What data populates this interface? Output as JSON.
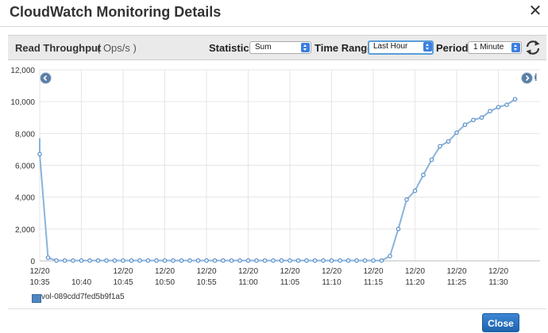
{
  "modal": {
    "title": "CloudWatch Monitoring Details"
  },
  "toolbar": {
    "metric_title": "Read Throughput",
    "metric_unit": "( Ops/s )",
    "statistic_label": "Statistic:",
    "statistic_value": "Sum",
    "time_range_label": "Time Range:",
    "time_range_value": "Last Hour",
    "period_label": "Period:",
    "period_value": "1 Minute"
  },
  "nav": {
    "to_end_glyph": "›|"
  },
  "footer": {
    "close_label": "Close"
  },
  "colors": {
    "series_line": "#89b3db",
    "series_marker": "#5a8fc7",
    "accent_button": "#2b74c4",
    "grid": "#e6e6e6"
  },
  "chart_data": {
    "type": "line",
    "ylim": [
      0,
      12000
    ],
    "y_ticks": [
      0,
      2000,
      4000,
      6000,
      8000,
      10000,
      12000
    ],
    "y_tick_labels": [
      "0",
      "2,000",
      "4,000",
      "6,000",
      "8,000",
      "10,000",
      "12,000"
    ],
    "x_start_minute": "10:35",
    "x_tick_labels": [
      {
        "date": "12/20",
        "time": "10:35"
      },
      {
        "date": "",
        "time": "10:40"
      },
      {
        "date": "12/20",
        "time": "10:45"
      },
      {
        "date": "12/20",
        "time": "10:50"
      },
      {
        "date": "12/20",
        "time": "10:55"
      },
      {
        "date": "12/20",
        "time": "11:00"
      },
      {
        "date": "12/20",
        "time": "11:05"
      },
      {
        "date": "12/20",
        "time": "11:10"
      },
      {
        "date": "12/20",
        "time": "11:15"
      },
      {
        "date": "12/20",
        "time": "11:20"
      },
      {
        "date": "12/20",
        "time": "11:25"
      },
      {
        "date": "12/20",
        "time": "11:30"
      }
    ],
    "x_tick_times": [
      "10:35",
      "10:40",
      "10:45",
      "10:50",
      "10:55",
      "11:00",
      "11:05",
      "11:10",
      "11:15",
      "11:20",
      "11:25",
      "11:30"
    ],
    "series": [
      {
        "name": "vol-089cdd7fed5b9f1a5",
        "entry_value": 7700,
        "points": [
          [
            "10:35",
            6700
          ],
          [
            "10:36",
            200
          ],
          [
            "10:37",
            20
          ],
          [
            "10:38",
            20
          ],
          [
            "10:39",
            20
          ],
          [
            "10:40",
            20
          ],
          [
            "10:41",
            20
          ],
          [
            "10:42",
            20
          ],
          [
            "10:43",
            20
          ],
          [
            "10:44",
            20
          ],
          [
            "10:45",
            20
          ],
          [
            "10:46",
            20
          ],
          [
            "10:47",
            20
          ],
          [
            "10:48",
            20
          ],
          [
            "10:49",
            20
          ],
          [
            "10:50",
            20
          ],
          [
            "10:51",
            20
          ],
          [
            "10:52",
            20
          ],
          [
            "10:53",
            20
          ],
          [
            "10:54",
            20
          ],
          [
            "10:55",
            20
          ],
          [
            "10:56",
            20
          ],
          [
            "10:57",
            20
          ],
          [
            "10:58",
            20
          ],
          [
            "10:59",
            20
          ],
          [
            "11:00",
            20
          ],
          [
            "11:01",
            20
          ],
          [
            "11:02",
            20
          ],
          [
            "11:03",
            20
          ],
          [
            "11:04",
            20
          ],
          [
            "11:05",
            20
          ],
          [
            "11:06",
            20
          ],
          [
            "11:07",
            20
          ],
          [
            "11:08",
            20
          ],
          [
            "11:09",
            20
          ],
          [
            "11:10",
            20
          ],
          [
            "11:11",
            20
          ],
          [
            "11:12",
            20
          ],
          [
            "11:13",
            20
          ],
          [
            "11:14",
            20
          ],
          [
            "11:15",
            20
          ],
          [
            "11:16",
            20
          ],
          [
            "11:17",
            300
          ],
          [
            "11:18",
            2000
          ],
          [
            "11:19",
            3850
          ],
          [
            "11:20",
            4400
          ],
          [
            "11:21",
            5400
          ],
          [
            "11:22",
            6350
          ],
          [
            "11:23",
            7200
          ],
          [
            "11:24",
            7500
          ],
          [
            "11:25",
            8050
          ],
          [
            "11:26",
            8550
          ],
          [
            "11:27",
            8850
          ],
          [
            "11:28",
            9000
          ],
          [
            "11:29",
            9400
          ],
          [
            "11:30",
            9650
          ],
          [
            "11:31",
            9800
          ],
          [
            "11:32",
            10150
          ]
        ]
      }
    ]
  }
}
